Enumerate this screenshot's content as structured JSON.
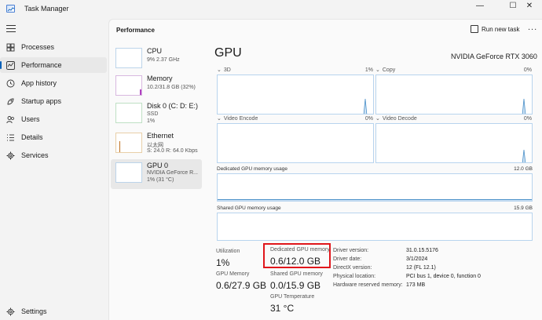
{
  "window": {
    "title": "Task Manager",
    "minimize_glyph": "—",
    "maximize_glyph": "☐",
    "close_glyph": "✕"
  },
  "sidebar": {
    "items": [
      {
        "label": "Processes",
        "icon": "processes-grid-icon"
      },
      {
        "label": "Performance",
        "icon": "performance-chart-icon",
        "active": true
      },
      {
        "label": "App history",
        "icon": "history-icon"
      },
      {
        "label": "Startup apps",
        "icon": "startup-icon"
      },
      {
        "label": "Users",
        "icon": "users-icon"
      },
      {
        "label": "Details",
        "icon": "details-list-icon"
      },
      {
        "label": "Services",
        "icon": "services-gear-icon"
      }
    ],
    "settings_label": "Settings"
  },
  "header": {
    "title": "Performance",
    "run_new_task": "Run new task",
    "more": "..."
  },
  "devices": [
    {
      "name": "CPU",
      "sub1": "9% 2.37 GHz",
      "sub2": ""
    },
    {
      "name": "Memory",
      "sub1": "10.2/31.8 GB (32%)",
      "sub2": ""
    },
    {
      "name": "Disk 0 (C: D: E:)",
      "sub1": "SSD",
      "sub2": "1%"
    },
    {
      "name": "Ethernet",
      "sub1": "以太网",
      "sub2": "S: 24.0 R: 64.0 Kbps"
    },
    {
      "name": "GPU 0",
      "sub1": "NVIDIA GeForce R...",
      "sub2": "1% (31 °C)",
      "active": true
    }
  ],
  "gpu": {
    "title": "GPU",
    "model": "NVIDIA GeForce RTX 3060",
    "graphs": [
      {
        "label": "3D",
        "pct": "1%"
      },
      {
        "label": "Copy",
        "pct": "0%"
      },
      {
        "label": "Video Encode",
        "pct": "0%"
      },
      {
        "label": "Video Decode",
        "pct": "0%"
      }
    ],
    "dedicated_label": "Dedicated GPU memory usage",
    "dedicated_max": "12.0 GB",
    "shared_label": "Shared GPU memory usage",
    "shared_max": "15.9 GB"
  },
  "stats": {
    "utilization_label": "Utilization",
    "utilization_value": "1%",
    "dedicated_label": "Dedicated GPU memory",
    "dedicated_value": "0.6/12.0 GB",
    "gpu_memory_label": "GPU Memory",
    "gpu_memory_value": "0.6/27.9 GB",
    "shared_label": "Shared GPU memory",
    "shared_value": "0.0/15.9 GB",
    "temp_label": "GPU Temperature",
    "temp_value": "31 °C"
  },
  "info": [
    {
      "key": "Driver version:",
      "value": "31.0.15.5176"
    },
    {
      "key": "Driver date:",
      "value": "3/1/2024"
    },
    {
      "key": "DirectX version:",
      "value": "12 (FL 12.1)"
    },
    {
      "key": "Physical location:",
      "value": "PCI bus 1, device 0, function 0"
    },
    {
      "key": "Hardware reserved memory:",
      "value": "173 MB"
    }
  ],
  "colors": {
    "accent": "#005fb8",
    "graph_border": "#b8d4ee",
    "graph_line": "#4a90c8",
    "highlight": "#e0161b",
    "cpu": "#1f7bc4",
    "memory": "#b040c0",
    "disk": "#3aa04a",
    "ethernet": "#c07020",
    "gpu": "#1f7bc4"
  }
}
